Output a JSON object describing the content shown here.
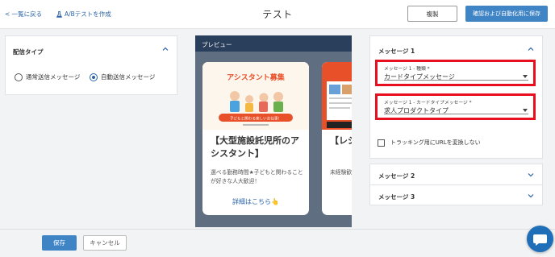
{
  "header": {
    "back_label": "< 一覧に戻る",
    "ab_test_label": "A/Bテストを作成",
    "page_title": "テスト",
    "copy_label": "複製",
    "save_optimize_label": "確認および自動化用に保存"
  },
  "left_panel": {
    "title": "配信タイプ",
    "options": [
      {
        "label": "通常送信メッセージ",
        "selected": false
      },
      {
        "label": "自動送信メッセージ",
        "selected": true
      }
    ]
  },
  "preview": {
    "header": "プレビュー",
    "cards": [
      {
        "image_heading": "アシスタント募集",
        "image_banner": "子どもと関わる楽しいお仕事！",
        "title": "【大型施設託児所のアシスタント】",
        "description": "選べる勤務時間★子どもと関わることが好きな人大歓迎！",
        "link": "詳細はこちら👆"
      },
      {
        "title": "【レジ店で接",
        "description": "未経験歓迎アルバイト",
        "link": ""
      }
    ]
  },
  "message1": {
    "title": "メッセージ 1",
    "type_field": {
      "label": "メッセージ 1 - 種類 *",
      "value": "カードタイプメッセージ"
    },
    "card_type_field": {
      "label": "メッセージ 1 - カードタイプメッセージ *",
      "value": "求人プロダクトタイプ"
    },
    "tracking_label": "トラッキング用にURLを変換しない"
  },
  "message2": {
    "title": "メッセージ 2"
  },
  "message3": {
    "title": "メッセージ 3"
  },
  "footer": {
    "save_label": "保存",
    "cancel_label": "キャンセル"
  },
  "colors": {
    "primary": "#3f84c4",
    "highlight": "#e8101e",
    "preview_header": "#2a3f5c",
    "chat": "#1f6fb8"
  }
}
